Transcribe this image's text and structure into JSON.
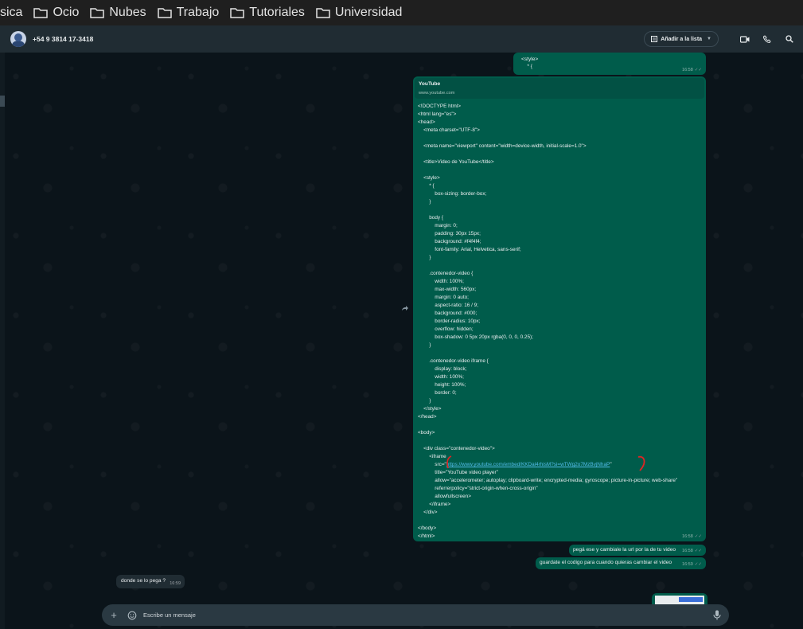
{
  "bookmarks": [
    {
      "label": "sica"
    },
    {
      "label": "Ocio"
    },
    {
      "label": "Nubes"
    },
    {
      "label": "Trabajo"
    },
    {
      "label": "Tutoriales"
    },
    {
      "label": "Universidad"
    }
  ],
  "header": {
    "contact": "+54 9 3814 17-3418",
    "add_to_list": "Añadir a la lista"
  },
  "messages": {
    "m1": {
      "text": "<style>\n    * {",
      "time": "16:58"
    },
    "m2": {
      "link_title": "YouTube",
      "link_url": "www.youtube.com",
      "code_before": "<!DOCTYPE html>\n<html lang=\"es\">\n<head>\n    <meta charset=\"UTF-8\">\n\n    <meta name=\"viewport\" content=\"width=device-width, initial-scale=1.0\">\n\n    <title>Video de YouTube</title>\n\n    <style>\n        * {\n            box-sizing: border-box;\n        }\n\n        body {\n            margin: 0;\n            padding: 30px 15px;\n            background: #f4f4f4;\n            font-family: Arial, Helvetica, sans-serif;\n        }\n\n        .contenedor-video {\n            width: 100%;\n            max-width: 560px;\n            margin: 0 auto;\n            aspect-ratio: 16 / 9;\n            background: #000;\n            border-radius: 10px;\n            overflow: hidden;\n            box-shadow: 0 5px 20px rgba(0, 0, 0, 0.25);\n        }\n\n        .contenedor-video iframe {\n            display: block;\n            width: 100%;\n            height: 100%;\n            border: 0;\n        }\n    </style>\n</head>\n\n<body>\n\n    <div class=\"contenedor-video\">\n        <iframe\n            src=\"",
      "code_link": "https://www.youtube.com/embed/KKDal4rhisM?si=wTWg2o7MzBvjNhaP",
      "code_after": "\"\n            title=\"YouTube video player\"\n            allow=\"accelerometer; autoplay; clipboard-write; encrypted-media; gyroscope; picture-in-picture; web-share\"\n            referrerpolicy=\"strict-origin-when-cross-origin\"\n            allowfullscreen>\n        </iframe>\n    </div>\n\n</body>\n</html>",
      "time": "16:58"
    },
    "m3": {
      "text": "pegá ese y cambiale la url por la de tu video",
      "time": "16:58"
    },
    "m4": {
      "text": "guardate el codigo para cuando quieras cambiar el video",
      "time": "16:59"
    },
    "m5": {
      "text": "donde se lo pega ?",
      "time": "16:59"
    }
  },
  "composer": {
    "placeholder": "Escribe un mensaje"
  },
  "colors": {
    "outgoing": "#005c4b",
    "incoming": "#202c33",
    "background": "#0b141a",
    "link": "#53bdeb"
  }
}
